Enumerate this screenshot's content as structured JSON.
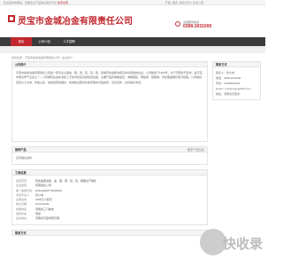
{
  "topbar": {
    "welcome": "欢迎来到本网站，中国企业产品信息发布平台",
    "register": "免费注册",
    "links": "产品 | 首页 | 联系方式 | 企业介绍"
  },
  "header": {
    "company_name": "灵宝市金城冶金有限责任公司",
    "phone_label": "全国服务热线",
    "phone_number": "0398-3031000"
  },
  "nav": {
    "items": [
      "首页",
      "公司介绍",
      "人才招聘"
    ]
  },
  "breadcrumb": "您的位置：灵宝市金城冶金有限责任公司 > 企业简介",
  "company_intro": {
    "title": "公司简介",
    "text": "灵宝市金城冶金有限责任公司是一家专业从事金、银、铜、铅、锌、硫、铋等有色金属冶炼及综合回收的企业，公司始建于1984年，位于河南省灵宝市，是灵宝市重点骨干企业之一。公司拥有先进的冶炼工艺技术和完善的检测设备，主要产品有电解金锭、电解银锭、阴极铜、硫酸等，年处理金精矿能力较强。公司始终坚持以人为本、科技兴企、诚信经营的理念，热诚欢迎国内外各界朋友光临指导、洽谈合作，共创美好未来。"
  },
  "products": {
    "title": "推荐产品",
    "more": "更多产品信息",
    "empty": "没有相关资料"
  },
  "business_info": {
    "title": "工商信息",
    "rows": [
      {
        "k": "经营范围",
        "v": "有色金属冶炼，金、银、铜、铅、锌、硫酸生产销售"
      },
      {
        "k": "企业类型",
        "v": "有限责任公司"
      },
      {
        "k": "统一信用代码",
        "v": "91411282077831933U"
      },
      {
        "k": "法定代表人",
        "v": "张小林"
      },
      {
        "k": "注册资本",
        "v": "1000万人民币"
      },
      {
        "k": "成立日期",
        "v": "2013-09-06"
      },
      {
        "k": "所属地区",
        "v": "河南省三门峡市"
      },
      {
        "k": "经营状态",
        "v": "存续"
      },
      {
        "k": "企业地址",
        "v": "河南省灵宝市阳平镇"
      }
    ]
  },
  "contact": {
    "title": "联系方式",
    "lines": [
      "联系人：张小林",
      "电话：0398-3031000",
      "手机：13939831000",
      "Email：jinchengye@163.com",
      "地址：河南省灵宝市"
    ]
  },
  "contact_bottom_title": "联系方式",
  "watermark": "快收录",
  "colors": {
    "brand": "#c1272d",
    "nav_bg": "#3b3b3b"
  }
}
